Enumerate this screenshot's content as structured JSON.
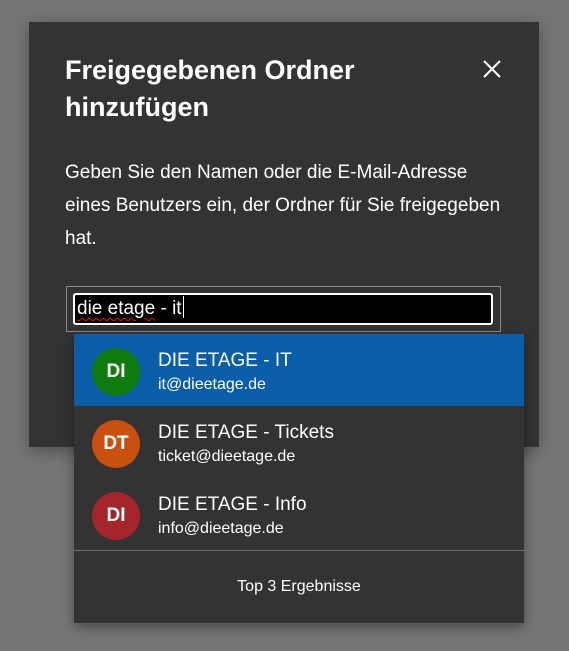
{
  "dialog": {
    "title": "Freigegebenen Ordner hinzufügen",
    "description": "Geben Sie den Namen oder die E-Mail-Adresse eines Benutzers ein, der Ordner für Sie freigegeben hat.",
    "close_icon": "close-icon"
  },
  "search": {
    "value_misspelled": "die etage",
    "value_rest": " - it",
    "value": "die etage - it"
  },
  "suggestions": {
    "items": [
      {
        "initials": "DI",
        "name": "DIE ETAGE - IT",
        "email": "it@dieetage.de",
        "avatar_color": "#107c10",
        "selected": true
      },
      {
        "initials": "DT",
        "name": "DIE ETAGE - Tickets",
        "email": "ticket@dieetage.de",
        "avatar_color": "#ca5010",
        "selected": false
      },
      {
        "initials": "DI",
        "name": "DIE ETAGE - Info",
        "email": "info@dieetage.de",
        "avatar_color": "#a4262c",
        "selected": false
      }
    ],
    "footer": "Top 3 Ergebnisse"
  },
  "colors": {
    "backdrop": "#767676",
    "dialog_bg": "#333333",
    "selected_bg": "#0a5ea8"
  }
}
